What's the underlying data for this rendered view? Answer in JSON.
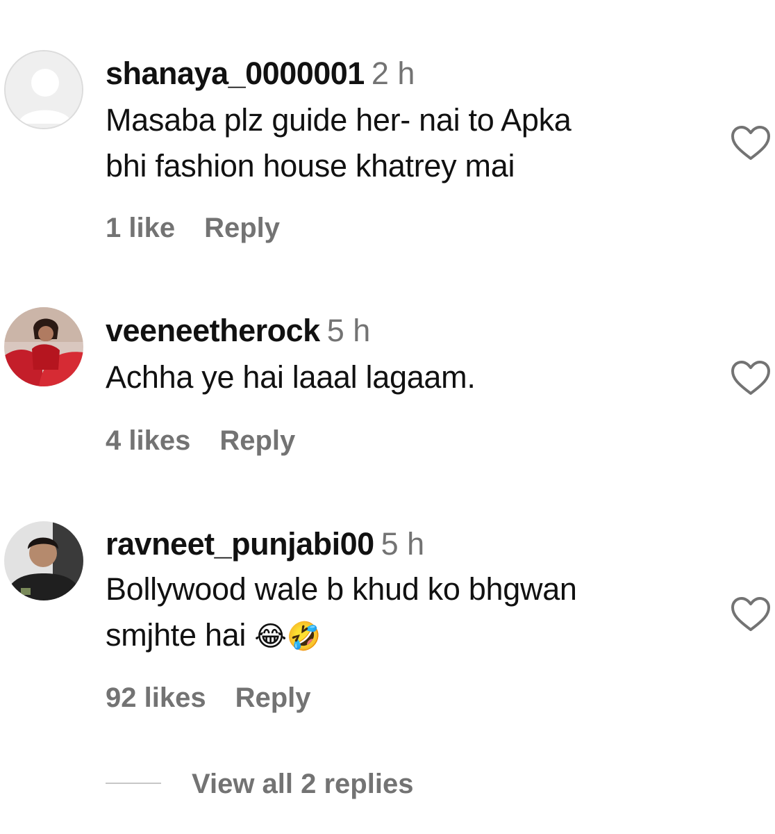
{
  "comments": [
    {
      "username": "shanaya_0000001",
      "time": "2 h",
      "text_lines": [
        "Masaba plz guide her- nai to Apka",
        "bhi fashion house khatrey mai"
      ],
      "emoji": "",
      "likes": "1 like",
      "reply_label": "Reply",
      "avatar": "default-avatar-icon"
    },
    {
      "username": "veeneetherock",
      "time": "5 h",
      "text_lines": [
        "Achha ye hai laaal lagaam."
      ],
      "emoji": "",
      "likes": "4 likes",
      "reply_label": "Reply",
      "avatar": "user-photo-red-dress"
    },
    {
      "username": "ravneet_punjabi00",
      "time": "5 h",
      "text_lines": [
        "Bollywood wale b khud ko bhgwan",
        "smjhte hai "
      ],
      "emoji": "😂🤣",
      "likes": "92 likes",
      "reply_label": "Reply",
      "avatar": "user-photo-man"
    }
  ],
  "view_replies": {
    "label": "View all 2 replies"
  },
  "colors": {
    "text": "#111111",
    "secondary": "#737373",
    "divider": "#c7c7c7"
  }
}
